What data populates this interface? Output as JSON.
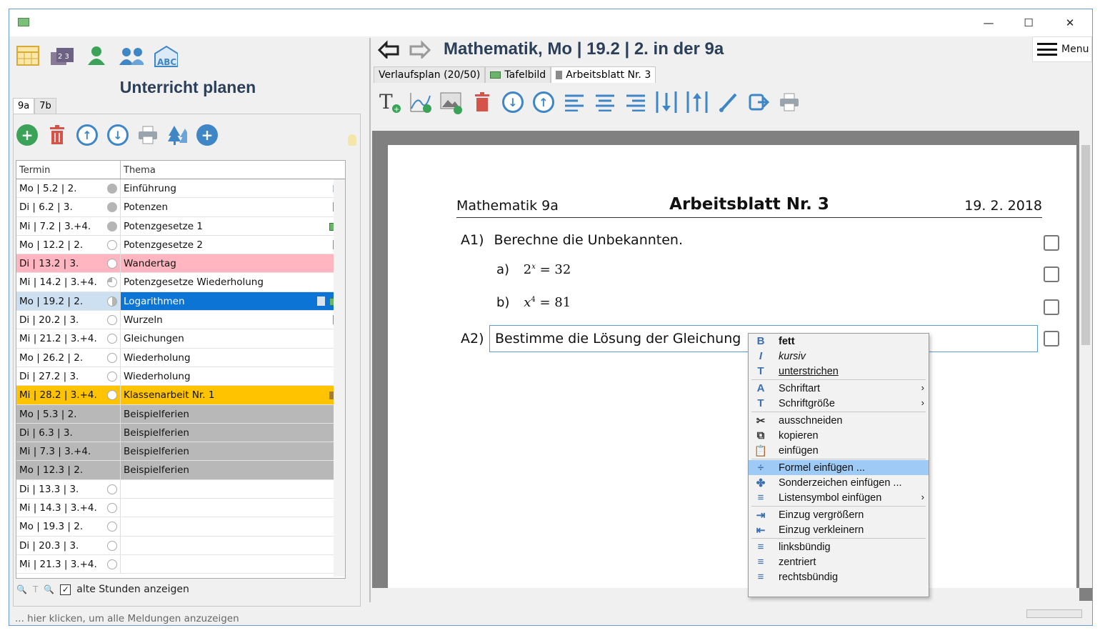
{
  "window": {
    "minimize": "—",
    "maximize": "☐",
    "close": "✕"
  },
  "left": {
    "heading": "Unterricht planen",
    "class_tabs": [
      "9a",
      "7b"
    ],
    "table": {
      "headers": [
        "Termin",
        "Thema"
      ],
      "rows": [
        {
          "termin": "Mo | 5.2 | 2.",
          "thema": "Einführung",
          "status": "full",
          "icon": "list-icon"
        },
        {
          "termin": "Di | 6.2 | 3.",
          "thema": "Potenzen",
          "status": "full",
          "icon": "document-icon"
        },
        {
          "termin": "Mi | 7.2 | 3.+4.",
          "thema": "Potenzgesetze 1",
          "status": "full",
          "icon": "board-icon"
        },
        {
          "termin": "Mo | 12.2 | 2.",
          "thema": "Potenzgesetze 2",
          "status": "empty",
          "icon": "document-icon"
        },
        {
          "termin": "Di | 13.2 | 3.",
          "thema": "Wandertag",
          "status": "empty",
          "icon": "",
          "style": "pink"
        },
        {
          "termin": "Mi | 14.2 | 3.+4.",
          "thema": "Potenzgesetze Wiederholung",
          "status": "quarter",
          "icon": ""
        },
        {
          "termin": "Mo | 19.2 | 2.",
          "thema": "Logarithmen",
          "status": "half",
          "icon": "board-icon",
          "style": "sel"
        },
        {
          "termin": "Di | 20.2 | 3.",
          "thema": "Wurzeln",
          "status": "empty",
          "icon": "document-icon"
        },
        {
          "termin": "Mi | 21.2 | 3.+4.",
          "thema": "Gleichungen",
          "status": "empty",
          "icon": ""
        },
        {
          "termin": "Mo | 26.2 | 2.",
          "thema": "Wiederholung",
          "status": "empty",
          "icon": ""
        },
        {
          "termin": "Di | 27.2 | 3.",
          "thema": "Wiederholung",
          "status": "empty",
          "icon": ""
        },
        {
          "termin": "Mi | 28.2 | 3.+4.",
          "thema": "Klassenarbeit Nr. 1",
          "status": "empty",
          "icon": "exam-icon",
          "style": "orange"
        },
        {
          "termin": "Mo | 5.3 | 2.",
          "thema": "Beispielferien",
          "status": "",
          "icon": "",
          "style": "gray"
        },
        {
          "termin": "Di | 6.3 | 3.",
          "thema": "Beispielferien",
          "status": "",
          "icon": "",
          "style": "gray"
        },
        {
          "termin": "Mi | 7.3 | 3.+4.",
          "thema": "Beispielferien",
          "status": "",
          "icon": "",
          "style": "gray"
        },
        {
          "termin": "Mo | 12.3 | 2.",
          "thema": "Beispielferien",
          "status": "",
          "icon": "",
          "style": "gray"
        },
        {
          "termin": "Di | 13.3 | 3.",
          "thema": "",
          "status": "empty",
          "icon": ""
        },
        {
          "termin": "Mi | 14.3 | 3.+4.",
          "thema": "",
          "status": "empty",
          "icon": ""
        },
        {
          "termin": "Mo | 19.3 | 2.",
          "thema": "",
          "status": "empty",
          "icon": ""
        },
        {
          "termin": "Di | 20.3 | 3.",
          "thema": "",
          "status": "empty",
          "icon": ""
        },
        {
          "termin": "Mi | 21.3 | 3.+4.",
          "thema": "",
          "status": "empty",
          "icon": ""
        }
      ]
    },
    "footer": {
      "checkbox_label": "alte Stunden anzeigen",
      "checked": true
    }
  },
  "right": {
    "title": "Mathematik, Mo | 19.2 | 2. in der 9a",
    "menu_label": "Menu",
    "tabs": [
      "Verlaufsplan (20/50)",
      "Tafelbild",
      "Arbeitsblatt Nr. 3"
    ],
    "active_tab": 2,
    "worksheet": {
      "subject": "Mathematik 9a",
      "title": "Arbeitsblatt Nr. 3",
      "date": "19. 2. 2018",
      "a1_label": "A1)",
      "a1_text": "Berechne die Unbekannten.",
      "a1a_label": "a)",
      "a1b_label": "b)",
      "a2_label": "A2)",
      "a2_text": "Bestimme die Lösung der Gleichung"
    }
  },
  "context_menu": {
    "items": [
      {
        "label": "fett",
        "icon": "B",
        "name": "bold"
      },
      {
        "label": "kursiv",
        "icon": "I",
        "name": "italic"
      },
      {
        "label": "unterstrichen",
        "icon": "T",
        "name": "underline"
      },
      {
        "sep": true
      },
      {
        "label": "Schriftart",
        "icon": "A",
        "name": "font",
        "submenu": true
      },
      {
        "label": "Schriftgröße",
        "icon": "T",
        "name": "font-size",
        "submenu": true
      },
      {
        "sep": true
      },
      {
        "label": "ausschneiden",
        "icon": "✂",
        "name": "cut"
      },
      {
        "label": "kopieren",
        "icon": "⧉",
        "name": "copy"
      },
      {
        "label": "einfügen",
        "icon": "📋",
        "name": "paste"
      },
      {
        "sep": true
      },
      {
        "label": "Formel einfügen ...",
        "icon": "÷",
        "name": "insert-formula",
        "highlighted": true
      },
      {
        "label": "Sonderzeichen einfügen ...",
        "icon": "✤",
        "name": "insert-symbol"
      },
      {
        "label": "Listensymbol einfügen",
        "icon": "≡",
        "name": "insert-list-symbol",
        "submenu": true
      },
      {
        "sep": true
      },
      {
        "label": "Einzug vergrößern",
        "icon": "⇥",
        "name": "indent-more"
      },
      {
        "label": "Einzug verkleinern",
        "icon": "⇤",
        "name": "indent-less"
      },
      {
        "sep": true
      },
      {
        "label": "linksbündig",
        "icon": "≡",
        "name": "align-left"
      },
      {
        "label": "zentriert",
        "icon": "≡",
        "name": "align-center"
      },
      {
        "label": "rechtsbündig",
        "icon": "≡",
        "name": "align-right"
      }
    ]
  },
  "statusbar": {
    "message": "... hier klicken, um alle Meldungen anzuzeigen"
  },
  "colors": {
    "heading": "#2b3f59",
    "selection": "#0b74d5",
    "pink_row": "#ffb6c1",
    "orange_row": "#ffc300",
    "holiday_row": "#b8b8b8",
    "menu_highlight": "#9ecbf5"
  }
}
